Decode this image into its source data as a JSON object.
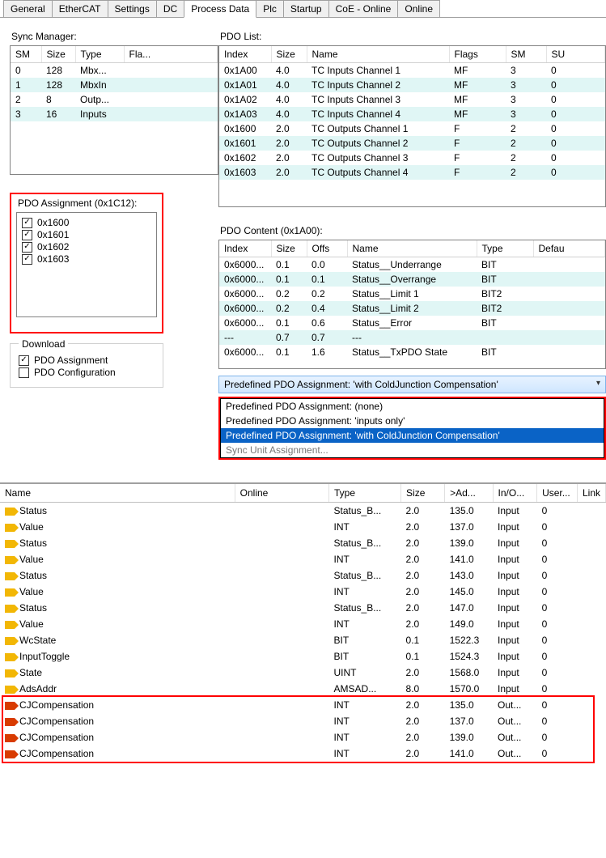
{
  "tabs": [
    "General",
    "EtherCAT",
    "Settings",
    "DC",
    "Process Data",
    "Plc",
    "Startup",
    "CoE - Online",
    "Online"
  ],
  "active_tab": "Process Data",
  "sync": {
    "label": "Sync Manager:",
    "headers": [
      "SM",
      "Size",
      "Type",
      "Fla..."
    ],
    "rows": [
      {
        "sm": "0",
        "size": "128",
        "type": "Mbx...",
        "flags": ""
      },
      {
        "sm": "1",
        "size": "128",
        "type": "MbxIn",
        "flags": ""
      },
      {
        "sm": "2",
        "size": "8",
        "type": "Outp...",
        "flags": ""
      },
      {
        "sm": "3",
        "size": "16",
        "type": "Inputs",
        "flags": ""
      }
    ]
  },
  "pdo_list": {
    "label": "PDO List:",
    "headers": [
      "Index",
      "Size",
      "Name",
      "Flags",
      "SM",
      "SU"
    ],
    "rows": [
      {
        "index": "0x1A00",
        "size": "4.0",
        "name": "TC Inputs Channel 1",
        "flags": "MF",
        "sm": "3",
        "su": "0"
      },
      {
        "index": "0x1A01",
        "size": "4.0",
        "name": "TC Inputs Channel 2",
        "flags": "MF",
        "sm": "3",
        "su": "0"
      },
      {
        "index": "0x1A02",
        "size": "4.0",
        "name": "TC Inputs Channel 3",
        "flags": "MF",
        "sm": "3",
        "su": "0"
      },
      {
        "index": "0x1A03",
        "size": "4.0",
        "name": "TC Inputs Channel 4",
        "flags": "MF",
        "sm": "3",
        "su": "0"
      },
      {
        "index": "0x1600",
        "size": "2.0",
        "name": "TC Outputs Channel 1",
        "flags": "F",
        "sm": "2",
        "su": "0"
      },
      {
        "index": "0x1601",
        "size": "2.0",
        "name": "TC Outputs Channel 2",
        "flags": "F",
        "sm": "2",
        "su": "0"
      },
      {
        "index": "0x1602",
        "size": "2.0",
        "name": "TC Outputs Channel 3",
        "flags": "F",
        "sm": "2",
        "su": "0"
      },
      {
        "index": "0x1603",
        "size": "2.0",
        "name": "TC Outputs Channel 4",
        "flags": "F",
        "sm": "2",
        "su": "0"
      }
    ]
  },
  "assignment": {
    "label": "PDO Assignment (0x1C12):",
    "items": [
      "0x1600",
      "0x1601",
      "0x1602",
      "0x1603"
    ]
  },
  "content": {
    "label": "PDO Content (0x1A00):",
    "headers": [
      "Index",
      "Size",
      "Offs",
      "Name",
      "Type",
      "Defau"
    ],
    "rows": [
      {
        "index": "0x6000...",
        "size": "0.1",
        "offs": "0.0",
        "name": "Status__Underrange",
        "type": "BIT"
      },
      {
        "index": "0x6000...",
        "size": "0.1",
        "offs": "0.1",
        "name": "Status__Overrange",
        "type": "BIT"
      },
      {
        "index": "0x6000...",
        "size": "0.2",
        "offs": "0.2",
        "name": "Status__Limit 1",
        "type": "BIT2"
      },
      {
        "index": "0x6000...",
        "size": "0.2",
        "offs": "0.4",
        "name": "Status__Limit 2",
        "type": "BIT2"
      },
      {
        "index": "0x6000...",
        "size": "0.1",
        "offs": "0.6",
        "name": "Status__Error",
        "type": "BIT"
      },
      {
        "index": "---",
        "size": "0.7",
        "offs": "0.7",
        "name": "---",
        "type": ""
      },
      {
        "index": "0x6000...",
        "size": "0.1",
        "offs": "1.6",
        "name": "Status__TxPDO State",
        "type": "BIT"
      }
    ]
  },
  "download": {
    "legend": "Download",
    "pdo_assignment": "PDO Assignment",
    "pdo_configuration": "PDO Configuration"
  },
  "predefined": {
    "visible": "Predefined PDO Assignment: 'with ColdJunction Compensation'",
    "options": [
      "Predefined PDO Assignment: (none)",
      "Predefined PDO Assignment: 'inputs only'",
      "Predefined PDO Assignment: 'with ColdJunction Compensation'"
    ],
    "selected_index": 2,
    "sync_unit": "Sync Unit Assignment..."
  },
  "grid": {
    "headers": [
      "Name",
      "Online",
      "Type",
      "Size",
      ">Ad...",
      "In/O...",
      "User...",
      "Link"
    ],
    "rows": [
      {
        "icon": "in",
        "name": "Status",
        "type": "Status_B...",
        "size": "2.0",
        "addr": "135.0",
        "io": "Input",
        "user": "0"
      },
      {
        "icon": "in",
        "name": "Value",
        "type": "INT",
        "size": "2.0",
        "addr": "137.0",
        "io": "Input",
        "user": "0"
      },
      {
        "icon": "in",
        "name": "Status",
        "type": "Status_B...",
        "size": "2.0",
        "addr": "139.0",
        "io": "Input",
        "user": "0"
      },
      {
        "icon": "in",
        "name": "Value",
        "type": "INT",
        "size": "2.0",
        "addr": "141.0",
        "io": "Input",
        "user": "0"
      },
      {
        "icon": "in",
        "name": "Status",
        "type": "Status_B...",
        "size": "2.0",
        "addr": "143.0",
        "io": "Input",
        "user": "0"
      },
      {
        "icon": "in",
        "name": "Value",
        "type": "INT",
        "size": "2.0",
        "addr": "145.0",
        "io": "Input",
        "user": "0"
      },
      {
        "icon": "in",
        "name": "Status",
        "type": "Status_B...",
        "size": "2.0",
        "addr": "147.0",
        "io": "Input",
        "user": "0"
      },
      {
        "icon": "in",
        "name": "Value",
        "type": "INT",
        "size": "2.0",
        "addr": "149.0",
        "io": "Input",
        "user": "0"
      },
      {
        "icon": "in",
        "name": "WcState",
        "type": "BIT",
        "size": "0.1",
        "addr": "1522.3",
        "io": "Input",
        "user": "0"
      },
      {
        "icon": "in",
        "name": "InputToggle",
        "type": "BIT",
        "size": "0.1",
        "addr": "1524.3",
        "io": "Input",
        "user": "0"
      },
      {
        "icon": "in",
        "name": "State",
        "type": "UINT",
        "size": "2.0",
        "addr": "1568.0",
        "io": "Input",
        "user": "0"
      },
      {
        "icon": "in",
        "name": "AdsAddr",
        "type": "AMSAD...",
        "size": "8.0",
        "addr": "1570.0",
        "io": "Input",
        "user": "0"
      },
      {
        "icon": "out",
        "name": "CJCompensation",
        "type": "INT",
        "size": "2.0",
        "addr": "135.0",
        "io": "Out...",
        "user": "0"
      },
      {
        "icon": "out",
        "name": "CJCompensation",
        "type": "INT",
        "size": "2.0",
        "addr": "137.0",
        "io": "Out...",
        "user": "0"
      },
      {
        "icon": "out",
        "name": "CJCompensation",
        "type": "INT",
        "size": "2.0",
        "addr": "139.0",
        "io": "Out...",
        "user": "0"
      },
      {
        "icon": "out",
        "name": "CJCompensation",
        "type": "INT",
        "size": "2.0",
        "addr": "141.0",
        "io": "Out...",
        "user": "0"
      }
    ]
  }
}
